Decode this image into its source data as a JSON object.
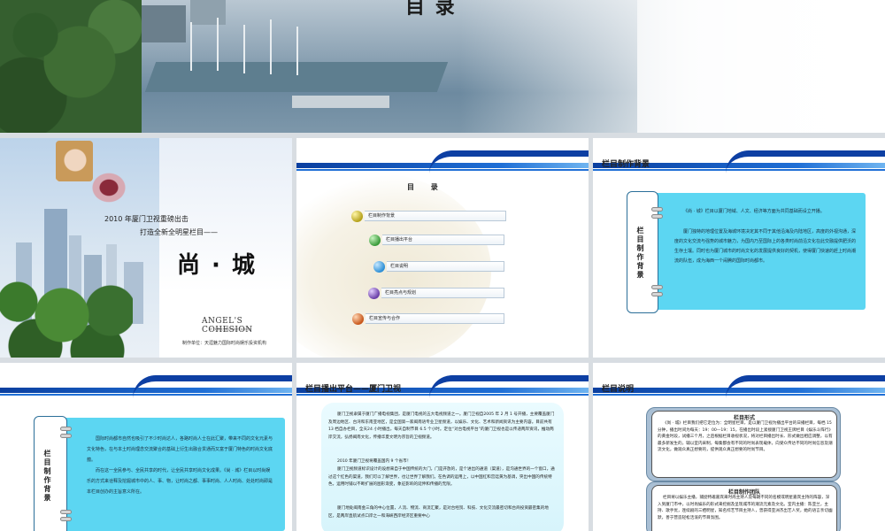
{
  "hero": {
    "title": "目 录"
  },
  "slide1": {
    "line1": "2010 年厦门卫视重磅出击",
    "line2": "打造全新全明星栏目——",
    "big_title": "尚 · 城",
    "brand": "ANGEL'S COHESION",
    "brand_sub": "厦门天涯魅力国际时尚娱乐投资机构",
    "producer": "制作单位：天涯魅力国际时尚娱乐投资机构"
  },
  "slide2": {
    "heading": "目 录",
    "items": [
      {
        "label": "栏目制作背景",
        "color": "#b5a21c"
      },
      {
        "label": "栏目播出平台",
        "color": "#3a9a3a"
      },
      {
        "label": "栏目说明",
        "color": "#2d8fd6"
      },
      {
        "label": "栏目亮点与规划",
        "color": "#6a3fa8"
      },
      {
        "label": "栏目宣传与合作",
        "color": "#c8571b"
      }
    ]
  },
  "slide3": {
    "title": "栏目制作背景",
    "side_label": "栏目制作背景",
    "paragraphs": [
      "《尚 · 城》栏目以厦门地域、人文、经济等方面为共同基础而设立开播。",
      "厦门独特的地理位置及海城环境决定其不同于其他沿海及内陆地区，高度的外视沟通，深度的文化交流与强势的城市魅力，为国内乃至国际上的各类时尚前沿文化在此交融提供肥沃的生存土壤。同时也为厦门城市的时尚文化的发展提供良好的契机，使得厦门快速的赶上时尚潮流的队伍，成为海西一个闹腾的国际时尚都市。"
    ]
  },
  "slide4": {
    "side_label": "栏目制作背景",
    "paragraphs": [
      "国际时尚都市自然也吸引了不少时尚达人，各路时尚人士在此汇聚，带来不同的文化元素与文化特色，在与本土时尚理念交流聚合的基础上衍生出融合贯通而又富于厦门特色的时尚文化底蕴。",
      "而在这一全民参与、全民共享的时代，让全民共享时尚文化成果。《尚 · 城》栏目以时尚娱乐的方式来诠释及挖掘城市中的人、事、物，让时尚之都、事事时尚、人人时尚、处处时尚即是本栏目创办的主旨意义所在。"
    ]
  },
  "slide5": {
    "title": "栏目播出平台——厦门卫视",
    "paragraphs": [
      "厦门卫视隶属于厦门广播电视集团，是厦门电视的五大电视频道之一。厦门卫视自2005 年 2 月 1 号开播，主要覆盖厦门及周边地区、台湾和东南亚地区，是全国第一家闽南语专业卫星频道，以娱乐、文化、艺术和新闻资讯为主要内容。目前共有 13 档自办栏目，全天24 小时播出，每天自制节目 6.5 个小时。定位“对台电视平台”的厦门卫视也是以传递两岸资讯，推动两岸交流，弘扬闽南文化，传播华夏文明为宗旨的卫视频道。",
      "2010 年厦门卫视将覆盖国内 9 个省市！",
      "厦门卫视频道标识设计的设想来自于中国传统的大门，门是开放的，是个进出的通道（渠道），是沟通世界的一个窗口，通过这个红色的渠道，我们可以了解世界，也让世界了解我们。在色调的运用上，以中国红和宫廷黄为基调，突出中国的传统特色，运用时铺以不断扩展的图形渐变，象征影响的延伸和传播的无限。",
      "厦门地处闽南金三角的中心位置，人流、物流、商流汇聚，是对台经贸、科技、文化交流最密切和台商投资最密集的地区，是两岸直航试点口岸之一和海峡西岸经济区重要中心"
    ]
  },
  "slide6": {
    "title": "栏目说明",
    "box1": {
      "title": "栏目形式",
      "text": "《尚 · 城》栏目我们把它定位为：全明星栏目，是以厦门卫视为播出平台的日播栏目，每档 15 分钟，播出时间为每天：19：00—19：15，在播出时段上紧接厦门卫视王牌栏目《娱乐斗阵行》的黄金时段，试播三个月，之后根据栏目收视状况，将对栏目播出时长、形式做出相应调整，以有最多新发生的，辅以室内采制，每集都会有不同的时尚表现载体，向受众传达不同的时尚信息及潮流文化，做观众真正想要的，提供观众真正想要的时尚节目。"
    },
    "box2": {
      "title": "栏目制作团队",
      "text": "栏目将以娱乐主播，捕捉特邀嘉宾来时尚主持人及每期不同的名模或明星嘉宾主持的阵容，深入到厦门市中，以时尚娱乐的形式来挖掘及呈现城市的潮流元素及文化。室内主播：陈亚兰，主持、歌手优，连续剧的三栖明星，知名综艺节目主持人，曾获得亚洲杰出艺人奖，她的语言亲切幽默，善于营造轻松活泼的节目氛围。"
    }
  }
}
